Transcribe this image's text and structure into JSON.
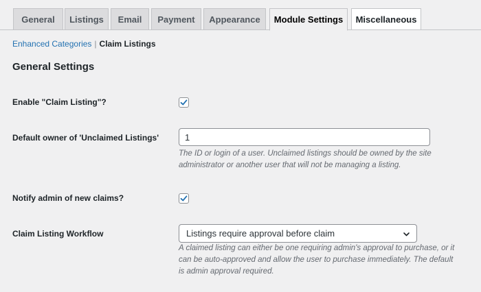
{
  "tabs": [
    {
      "label": "General"
    },
    {
      "label": "Listings"
    },
    {
      "label": "Email"
    },
    {
      "label": "Payment"
    },
    {
      "label": "Appearance"
    },
    {
      "label": "Module Settings"
    },
    {
      "label": "Miscellaneous"
    }
  ],
  "active_tab": "Module Settings",
  "subnav": {
    "link": "Enhanced Categories",
    "separator": "|",
    "current": "Claim Listings"
  },
  "section_title": "General Settings",
  "settings": {
    "enable_claim": {
      "label": "Enable \"Claim Listing\"?",
      "checked": true
    },
    "default_owner": {
      "label": "Default owner of 'Unclaimed Listings'",
      "value": "1",
      "description_line1": "The ID or login of a user. Unclaimed listings should be owned by the site",
      "description_line2": "administrator or another user that will not be managing a listing."
    },
    "notify_admin": {
      "label": "Notify admin of new claims?",
      "checked": true
    },
    "workflow": {
      "label": "Claim Listing Workflow",
      "selected": "Listings require approval before claim",
      "description_line1": "A claimed listing can either be one requiring admin's approval to purchase, or it",
      "description_line2": "can be auto-approved and allow the user to purchase immediately. The default",
      "description_line3": "is admin approval required."
    }
  },
  "colors": {
    "link": "#2271b1",
    "checkbox_check": "#2271b1"
  }
}
